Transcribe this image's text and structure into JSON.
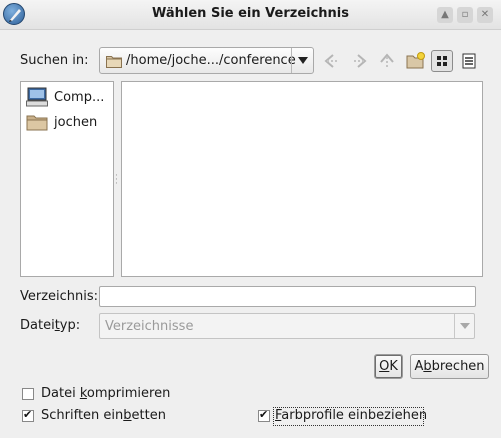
{
  "window": {
    "title": "Wählen Sie ein Verzeichnis",
    "controls": [
      "up",
      "restore",
      "close"
    ]
  },
  "toolbar": {
    "lookin_label_pre": "Suchen in",
    "lookin_label_post": ":",
    "path": "/home/joche.../conference",
    "icons": [
      "back-icon",
      "forward-icon",
      "parent-dir-icon",
      "new-folder-icon",
      "icon-view-icon",
      "list-view-icon"
    ]
  },
  "sidebar": {
    "items": [
      {
        "label": "Comp...",
        "icon": "computer-icon"
      },
      {
        "label": "jochen",
        "icon": "folder-icon"
      }
    ]
  },
  "form": {
    "directory_label_pre": "Verzeichnis",
    "directory_label_post": ":",
    "directory_value": "",
    "filetype_label_pre": "Datei",
    "filetype_label_ul": "t",
    "filetype_label_post": "yp:",
    "filetype_value": "Verzeichnisse"
  },
  "buttons": {
    "ok_ul": "O",
    "ok_rest": "K",
    "cancel_pre": "A",
    "cancel_ul": "b",
    "cancel_rest": "brechen"
  },
  "options": [
    {
      "pre": "Datei ",
      "ul": "k",
      "post": "omprimieren",
      "checked": false
    },
    {
      "pre": "Schriften ein",
      "ul": "b",
      "post": "etten",
      "checked": true
    },
    {
      "pre": "",
      "ul": "F",
      "post": "arbprofile einbeziehen",
      "checked": true
    }
  ],
  "colors": {
    "window_bg": "#efefef",
    "border": "#a9a9a9",
    "disabled_text": "#9a9a9a"
  }
}
